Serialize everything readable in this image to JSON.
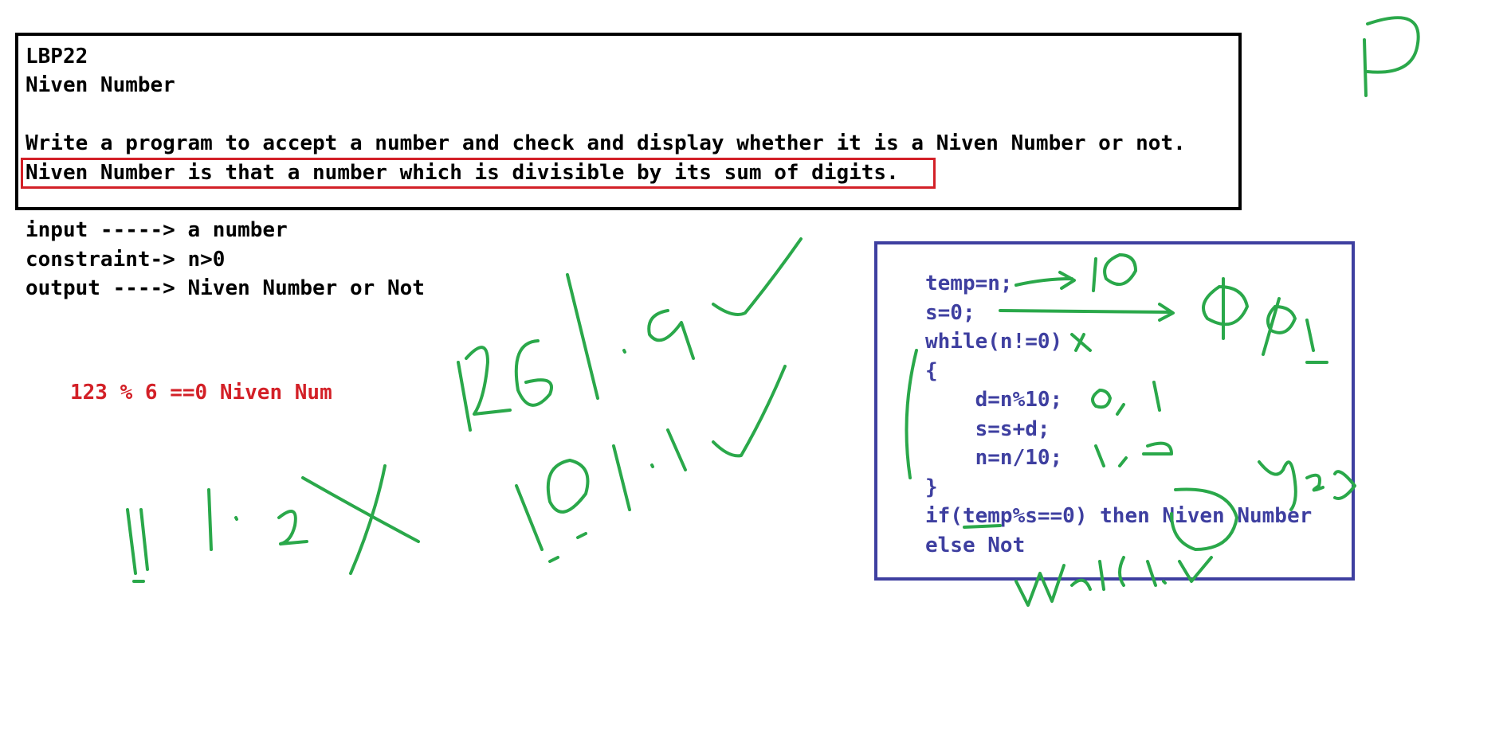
{
  "problem": {
    "code": "LBP22",
    "title": "Niven Number",
    "statement": "Write a program to accept a number and check and display whether it is a Niven Number or not.",
    "definition": "Niven Number is that a number which is divisible by its sum of digits."
  },
  "spec": {
    "input": "input -----> a number",
    "constraint": "constraint-> n>0",
    "output": "output ----> Niven Number or Not"
  },
  "example_note": "123 % 6 ==0 Niven Num",
  "code_lines": [
    "temp=n;",
    "s=0;",
    "while(n!=0)",
    "{",
    "    d=n%10;",
    "    s=s+d;",
    "    n=n/10;",
    "}",
    "if(temp%s==0) then Niven Number",
    "else Not"
  ],
  "colors": {
    "code": "#3e3fa0",
    "highlight": "#d32027",
    "ink": "#2aa84a"
  }
}
